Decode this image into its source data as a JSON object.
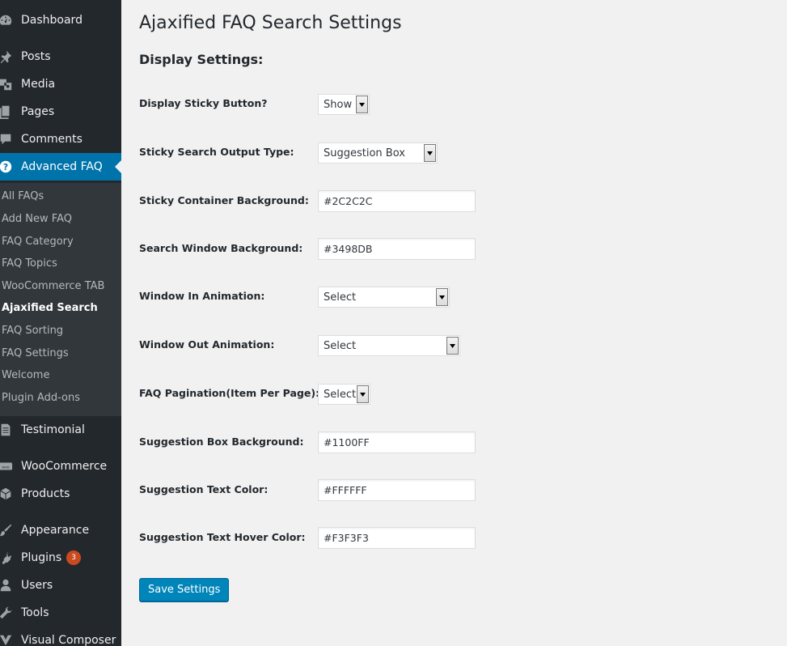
{
  "sidebar": {
    "menu": [
      {
        "label": "Dashboard",
        "icon": "dashboard-icon"
      },
      {
        "label": "Posts",
        "icon": "pin-icon"
      },
      {
        "label": "Media",
        "icon": "media-icon"
      },
      {
        "label": "Pages",
        "icon": "pages-icon"
      },
      {
        "label": "Comments",
        "icon": "comment-icon"
      },
      {
        "label": "Advanced FAQ",
        "icon": "help-icon"
      },
      {
        "label": "Testimonial",
        "icon": "document-icon"
      },
      {
        "label": "WooCommerce",
        "icon": "woocommerce-icon"
      },
      {
        "label": "Products",
        "icon": "cube-icon"
      },
      {
        "label": "Appearance",
        "icon": "brush-icon"
      },
      {
        "label": "Plugins",
        "icon": "plug-icon",
        "badge": "3"
      },
      {
        "label": "Users",
        "icon": "user-icon"
      },
      {
        "label": "Tools",
        "icon": "wrench-icon"
      },
      {
        "label": "Visual Composer",
        "icon": "vc-icon"
      }
    ],
    "submenu": [
      "All FAQs",
      "Add New FAQ",
      "FAQ Category",
      "FAQ Topics",
      "WooCommerce TAB",
      "Ajaxified Search",
      "FAQ Sorting",
      "FAQ Settings",
      "Welcome",
      "Plugin Add-ons"
    ],
    "active_submenu": "Ajaxified Search",
    "colors": {
      "background": "#23282d",
      "submenu": "#32373c",
      "current": "#0073aa",
      "badge": "#ca4a1f"
    }
  },
  "page": {
    "title": "Ajaxified FAQ Search Settings",
    "section_title": "Display Settings:",
    "fields": [
      {
        "label": "Display Sticky Button?",
        "type": "select",
        "value": "Show"
      },
      {
        "label": "Sticky Search Output Type:",
        "type": "select",
        "value": "Suggestion Box"
      },
      {
        "label": "Sticky Container Background:",
        "type": "text",
        "value": "#2C2C2C"
      },
      {
        "label": "Search Window Background:",
        "type": "text",
        "value": "#3498DB"
      },
      {
        "label": "Window In Animation:",
        "type": "select",
        "value": "Select"
      },
      {
        "label": "Window Out Animation:",
        "type": "select",
        "value": "Select"
      },
      {
        "label": "FAQ Pagination(Item Per Page):",
        "type": "select",
        "value": "Select"
      },
      {
        "label": "Suggestion Box Background:",
        "type": "text",
        "value": "#1100FF"
      },
      {
        "label": "Suggestion Text Color:",
        "type": "text",
        "value": "#FFFFFF"
      },
      {
        "label": "Suggestion Text Hover Color:",
        "type": "text",
        "value": "#F3F3F3"
      }
    ],
    "save_label": "Save Settings",
    "accent_color": "#0085ba"
  }
}
